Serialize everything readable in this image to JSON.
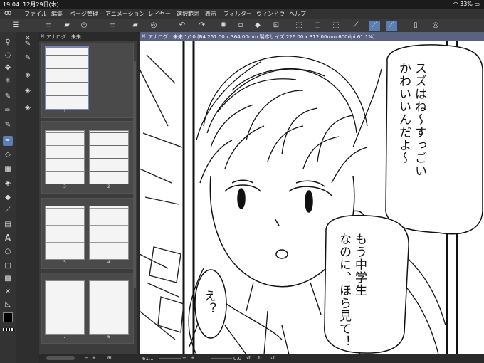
{
  "status": {
    "time": "19:04",
    "date": "12月29日(木)",
    "battery": "33%"
  },
  "menu": {
    "logo_icon": "clip-studio-logo-icon",
    "items": [
      "ファイル",
      "編集",
      "ページ管理",
      "アニメーション",
      "レイヤー",
      "選択範囲",
      "表示",
      "フィルター",
      "ウィンドウ",
      "ヘルプ"
    ]
  },
  "page_manager": {
    "tab_title": "アナログ　未来",
    "pages": [
      "1",
      "3",
      "2",
      "5",
      "4",
      "7",
      "6"
    ]
  },
  "document": {
    "tab_title": "アナログ　未来 1/10 (B4 257.00 x 364.00mm 製本サイズ:226.00 x 312.00mm 600dpi 61.1%)",
    "zoom": "61.1",
    "rotation": "0.0"
  },
  "speech": {
    "bubble1": [
      "スズはね〜すっごい",
      "かわいいんだよ〜"
    ],
    "bubble2": [
      "もう中学生",
      "なのに、ほら見て！"
    ],
    "bubble3": [
      "え？"
    ]
  },
  "colors": {
    "accent": "#5b7fb5",
    "main_color": "#000000",
    "sub_color": "#ffffff"
  }
}
